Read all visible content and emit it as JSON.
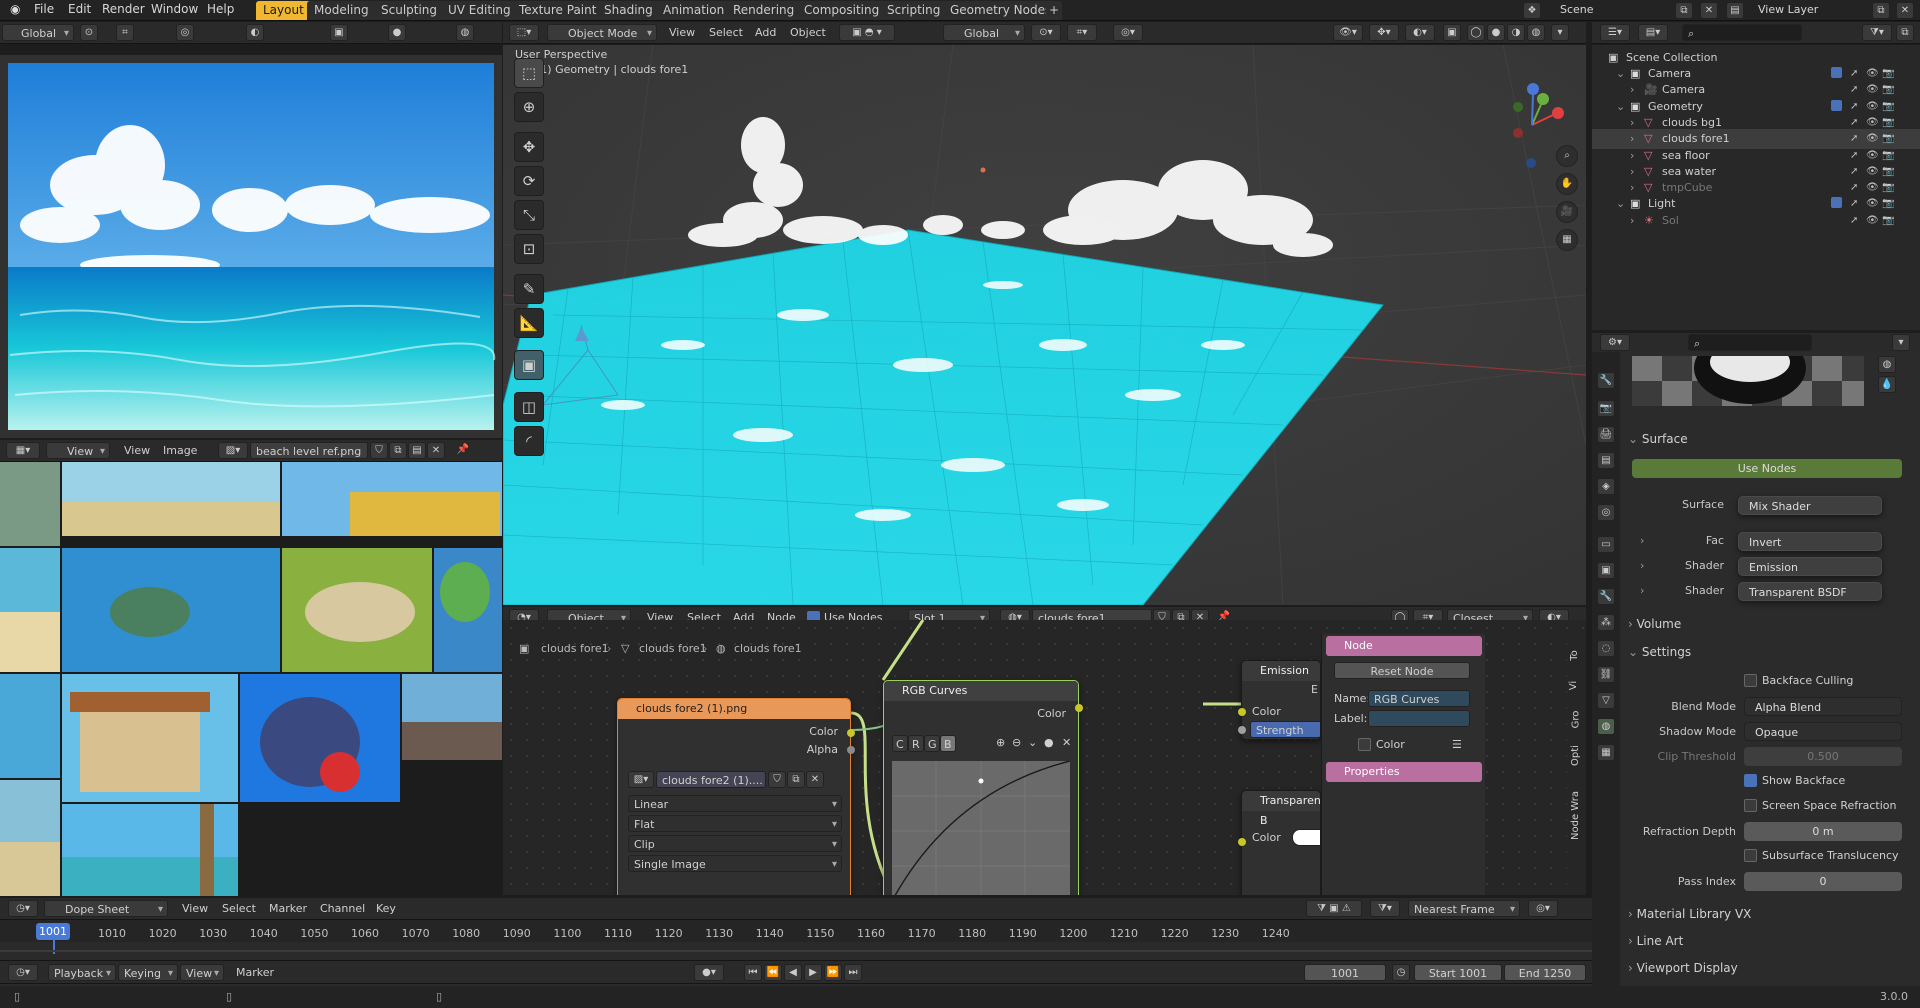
{
  "menus": [
    "File",
    "Edit",
    "Render",
    "Window",
    "Help"
  ],
  "workspaces": [
    "Layout",
    "Modeling",
    "Sculpting",
    "UV Editing",
    "Texture Paint",
    "Shading",
    "Animation",
    "Rendering",
    "Compositing",
    "Scripting",
    "Geometry Nodes"
  ],
  "active_workspace": "Layout",
  "scene_name": "Scene",
  "view_layer": "View Layer",
  "left_header": {
    "orientation": "Global"
  },
  "viewport": {
    "mode": "Object Mode",
    "menus": [
      "View",
      "Select",
      "Add",
      "Object"
    ],
    "orientation": "Global",
    "perspective": "User Perspective",
    "selection": "(1001) Geometry | clouds fore1"
  },
  "image_editor": {
    "menus": [
      "View",
      "Image"
    ],
    "view_label": "View",
    "image_name": "beach level ref.png"
  },
  "outliner": {
    "root": "Scene Collection",
    "rows": [
      {
        "label": "Camera",
        "level": 1
      },
      {
        "label": "Camera",
        "level": 2
      },
      {
        "label": "Geometry",
        "level": 1
      },
      {
        "label": "clouds bg1",
        "level": 2
      },
      {
        "label": "clouds fore1",
        "level": 2
      },
      {
        "label": "sea floor",
        "level": 2
      },
      {
        "label": "sea water",
        "level": 2
      },
      {
        "label": "tmpCube",
        "level": 2
      },
      {
        "label": "Light",
        "level": 1
      },
      {
        "label": "Sol",
        "level": 2
      }
    ]
  },
  "properties": {
    "surface_section": "Surface",
    "use_nodes": "Use Nodes",
    "surface_label": "Surface",
    "surface_value": "Mix Shader",
    "fac_label": "Fac",
    "fac_value": "Invert",
    "shader_label": "Shader",
    "shader1": "Emission",
    "shader2": "Transparent BSDF",
    "volume_section": "Volume",
    "settings_section": "Settings",
    "backface_culling": "Backface Culling",
    "blend_mode_label": "Blend Mode",
    "blend_mode": "Alpha Blend",
    "shadow_mode_label": "Shadow Mode",
    "shadow_mode": "Opaque",
    "clip_threshold_label": "Clip Threshold",
    "clip_threshold": "0.500",
    "show_backface": "Show Backface",
    "screen_space_refraction": "Screen Space Refraction",
    "refraction_depth_label": "Refraction Depth",
    "refraction_depth": "0 m",
    "subsurface_translucency": "Subsurface Translucency",
    "pass_index_label": "Pass Index",
    "pass_index": "0",
    "material_library": "Material Library VX",
    "line_art": "Line Art",
    "viewport_display": "Viewport Display"
  },
  "node_editor": {
    "type": "Object",
    "menus": [
      "View",
      "Select",
      "Add",
      "Node"
    ],
    "use_nodes": "Use Nodes",
    "slot": "Slot 1",
    "material": "clouds fore1",
    "interpolation": "Closest",
    "breadcrumbs": [
      "clouds fore1",
      "clouds fore1",
      "clouds fore1"
    ],
    "image_node": {
      "title": "clouds fore2 (1).png",
      "out_color": "Color",
      "out_alpha": "Alpha",
      "image": "clouds fore2 (1)....",
      "interp": "Linear",
      "projection": "Flat",
      "extension": "Clip",
      "source": "Single Image"
    },
    "curves_node": {
      "title": "RGB Curves",
      "out": "Color",
      "channels": [
        "C",
        "R",
        "G",
        "B"
      ]
    },
    "emission_node": {
      "title": "Emission",
      "out_frag": "E",
      "color": "Color",
      "strength": "Strength"
    },
    "transparent_node": {
      "title": "Transparent B",
      "color": "Color"
    },
    "n_panel": {
      "section": "Node",
      "reset": "Reset Node",
      "name_label": "Name:",
      "name": "RGB Curves",
      "label_label": "Label:",
      "color": "Color",
      "properties": "Properties"
    },
    "side_tabs": [
      "To",
      "Vi",
      "Gro",
      "Opti",
      "Node Wra"
    ]
  },
  "timeline": {
    "editor": "Dope Sheet",
    "menus": [
      "View",
      "Select",
      "Marker",
      "Channel",
      "Key"
    ],
    "snap": "Nearest Frame",
    "current_frame": "1001",
    "ticks": [
      "1010",
      "1020",
      "1030",
      "1040",
      "1050",
      "1060",
      "1070",
      "1080",
      "1090",
      "1100",
      "1110",
      "1120",
      "1130",
      "1140",
      "1150",
      "1160",
      "1170",
      "1180",
      "1190",
      "1200",
      "1210",
      "1220",
      "1230",
      "1240"
    ],
    "playback": "Playback",
    "keying": "Keying",
    "view": "View",
    "marker": "Marker",
    "frame_display": "1001",
    "start_label": "Start",
    "start": "1001",
    "end_label": "End",
    "end": "1250"
  },
  "version": "3.0.0"
}
